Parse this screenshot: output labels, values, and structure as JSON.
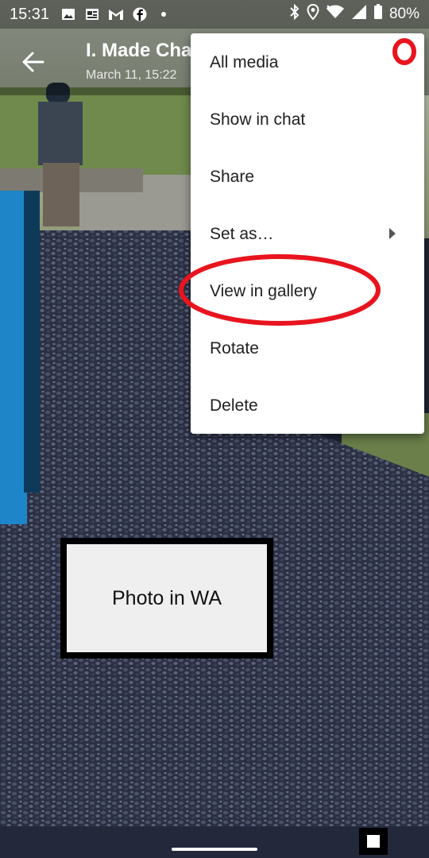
{
  "status_bar": {
    "time": "15:31",
    "battery_percent": "80%",
    "left_icons": [
      "image-icon",
      "news-icon",
      "gmail-icon",
      "facebook-icon",
      "dot-icon"
    ],
    "right_icons": [
      "bluetooth-icon",
      "location-icon",
      "wifi-icon",
      "signal-icon",
      "battery-icon"
    ]
  },
  "app_bar": {
    "title": "I. Made Cha",
    "subtitle": "March 11, 15:22"
  },
  "menu": {
    "items": [
      {
        "label": "All media"
      },
      {
        "label": "Show in chat"
      },
      {
        "label": "Share"
      },
      {
        "label": "Set as…",
        "has_submenu": true
      },
      {
        "label": "View in gallery",
        "highlighted": true
      },
      {
        "label": "Rotate"
      },
      {
        "label": "Delete"
      }
    ]
  },
  "caption": {
    "text": "Photo in WA"
  },
  "colors": {
    "annotation": "#e8141e",
    "menu_bg": "#ffffff",
    "gravel": "#2b3043"
  }
}
